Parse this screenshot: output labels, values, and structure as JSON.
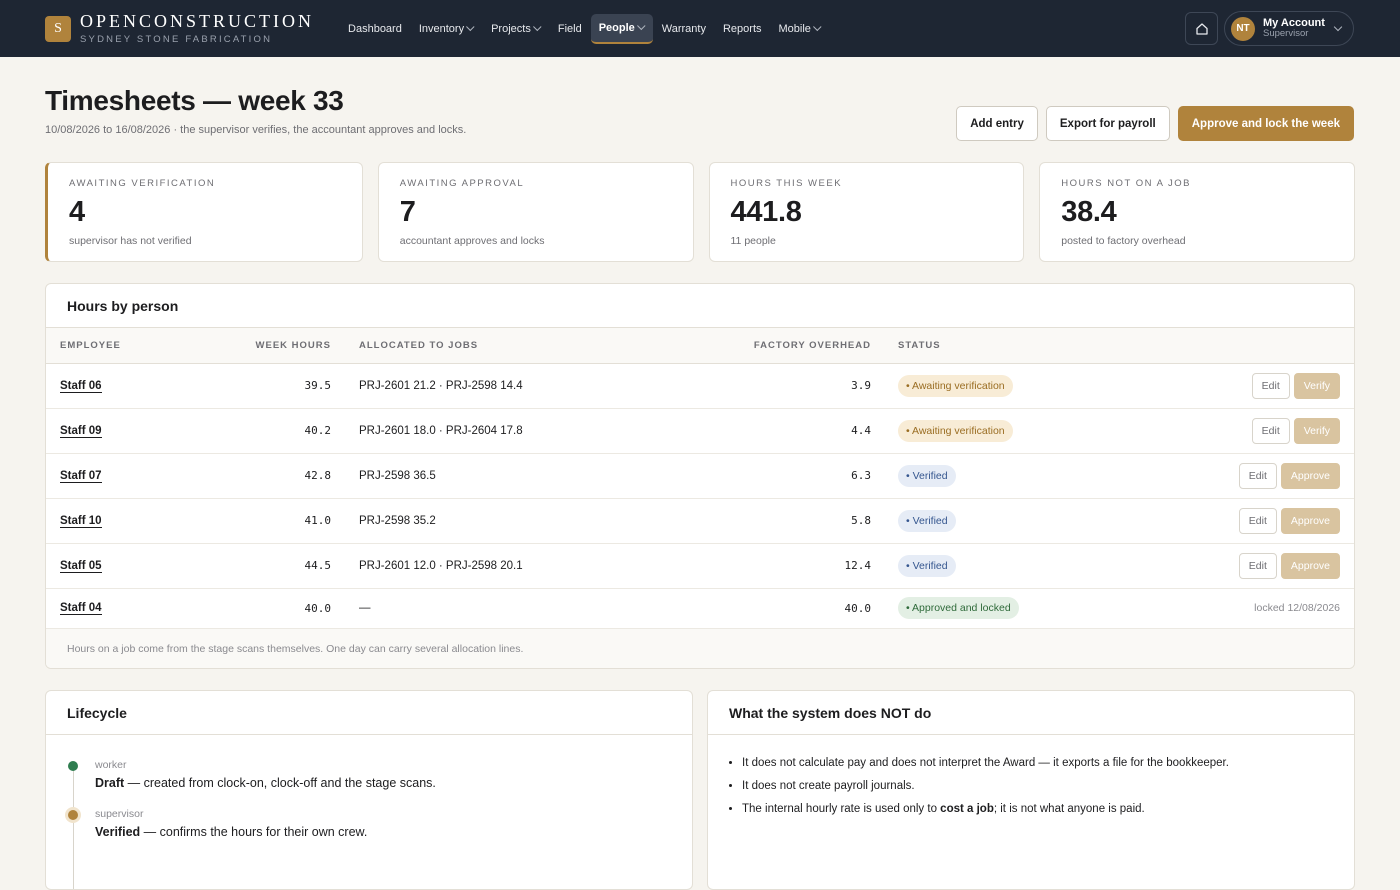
{
  "brand": {
    "mark": "S",
    "name": "OPENCONSTRUCTION",
    "sub": "SYDNEY STONE FABRICATION"
  },
  "nav": [
    {
      "label": "Dashboard",
      "dropdown": false
    },
    {
      "label": "Inventory",
      "dropdown": true
    },
    {
      "label": "Projects",
      "dropdown": true
    },
    {
      "label": "Field",
      "dropdown": false
    },
    {
      "label": "People",
      "dropdown": true,
      "active": true
    },
    {
      "label": "Warranty",
      "dropdown": false
    },
    {
      "label": "Reports",
      "dropdown": false
    },
    {
      "label": "Mobile",
      "dropdown": true
    }
  ],
  "account": {
    "initials": "NT",
    "name": "My Account",
    "role": "Supervisor"
  },
  "page": {
    "title": "Timesheets — week 33",
    "subtitle": "10/08/2026 to 16/08/2026 · the supervisor verifies, the accountant approves and locks."
  },
  "actions": {
    "add": "Add entry",
    "export": "Export for payroll",
    "approve": "Approve and lock the week"
  },
  "kpis": [
    {
      "label": "Awaiting verification",
      "value": "4",
      "note": "supervisor has not verified"
    },
    {
      "label": "Awaiting approval",
      "value": "7",
      "note": "accountant approves and locks"
    },
    {
      "label": "Hours this week",
      "value": "441.8",
      "note": "11 people"
    },
    {
      "label": "Hours not on a job",
      "value": "38.4",
      "note": "posted to factory overhead"
    }
  ],
  "hours": {
    "title": "Hours by person",
    "columns": {
      "employee": "Employee",
      "week_hours": "Week hours",
      "allocated": "Allocated to jobs",
      "overhead": "Factory overhead",
      "status": "Status"
    },
    "rows": [
      {
        "employee": "Staff 06",
        "hours": "39.5",
        "allocated": "PRJ-2601 21.2 · PRJ-2598 14.4",
        "overhead": "3.9",
        "status": "Awaiting verification",
        "kind": "wait",
        "edit": "Edit",
        "action": "Verify"
      },
      {
        "employee": "Staff 09",
        "hours": "40.2",
        "allocated": "PRJ-2601 18.0 · PRJ-2604 17.8",
        "overhead": "4.4",
        "status": "Awaiting verification",
        "kind": "wait",
        "edit": "Edit",
        "action": "Verify"
      },
      {
        "employee": "Staff 07",
        "hours": "42.8",
        "allocated": "PRJ-2598 36.5",
        "overhead": "6.3",
        "status": "Verified",
        "kind": "ver",
        "edit": "Edit",
        "action": "Approve"
      },
      {
        "employee": "Staff 10",
        "hours": "41.0",
        "allocated": "PRJ-2598 35.2",
        "overhead": "5.8",
        "status": "Verified",
        "kind": "ver",
        "edit": "Edit",
        "action": "Approve"
      },
      {
        "employee": "Staff 05",
        "hours": "44.5",
        "allocated": "PRJ-2601 12.0 · PRJ-2598 20.1",
        "overhead": "12.4",
        "status": "Verified",
        "kind": "ver",
        "edit": "Edit",
        "action": "Approve"
      },
      {
        "employee": "Staff 04",
        "hours": "40.0",
        "allocated": "—",
        "overhead": "40.0",
        "status": "Approved and locked",
        "kind": "lock",
        "locked": "locked 12/08/2026"
      }
    ],
    "footnote": "Hours on a job come from the stage scans themselves. One day can carry several allocation lines."
  },
  "lifecycle": {
    "title": "Lifecycle",
    "steps": [
      {
        "role": "worker",
        "name": "Draft",
        "text": " — created from clock-on, clock-off and the stage scans."
      },
      {
        "role": "supervisor",
        "name": "Verified",
        "text": " — confirms the hours for their own crew."
      }
    ]
  },
  "not_do": {
    "title": "What the system does NOT do",
    "item1": "It does not calculate pay and does not interpret the Award — it exports a file for the bookkeeper.",
    "item2": "It does not create payroll journals.",
    "item3_a": "The internal hourly rate is used only to ",
    "item3_b": "cost a job",
    "item3_c": "; it is not what anyone is paid."
  },
  "colors": {
    "nav_bg": "#1e2633",
    "accent": "#b0833c",
    "page_bg": "#f6f4ef"
  }
}
